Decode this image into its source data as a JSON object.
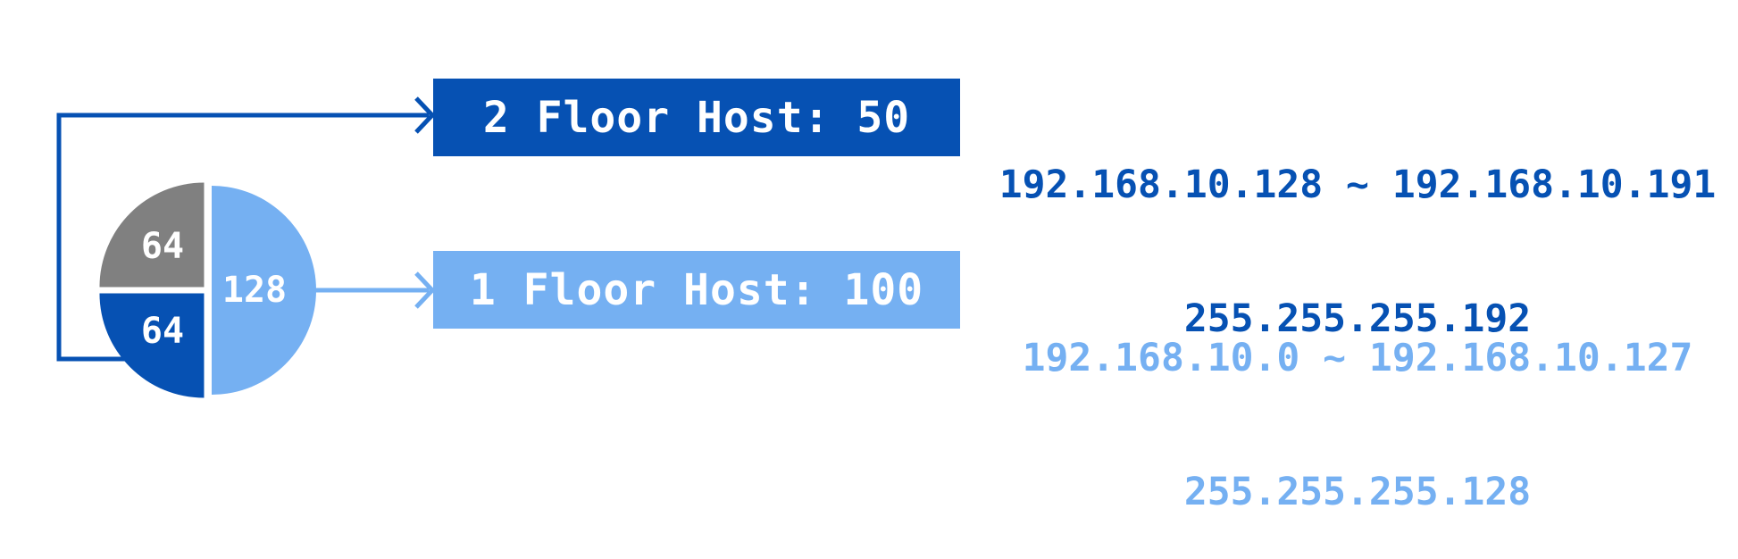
{
  "colors": {
    "dark_blue": "#0651b3",
    "light_blue": "#75b0f2",
    "gray": "#808080",
    "white": "#ffffff"
  },
  "pie": {
    "slices": [
      {
        "label": "64",
        "value": 64,
        "color": "gray"
      },
      {
        "label": "64",
        "value": 64,
        "color": "dark_blue"
      },
      {
        "label": "128",
        "value": 128,
        "color": "light_blue"
      }
    ]
  },
  "floors": [
    {
      "title": "2 Floor Host: 50",
      "range": "192.168.10.128 ~ 192.168.10.191",
      "mask": "255.255.255.192",
      "color": "dark_blue"
    },
    {
      "title": "1 Floor Host: 100",
      "range": "192.168.10.0 ~ 192.168.10.127",
      "mask": "255.255.255.128",
      "color": "light_blue"
    }
  ]
}
